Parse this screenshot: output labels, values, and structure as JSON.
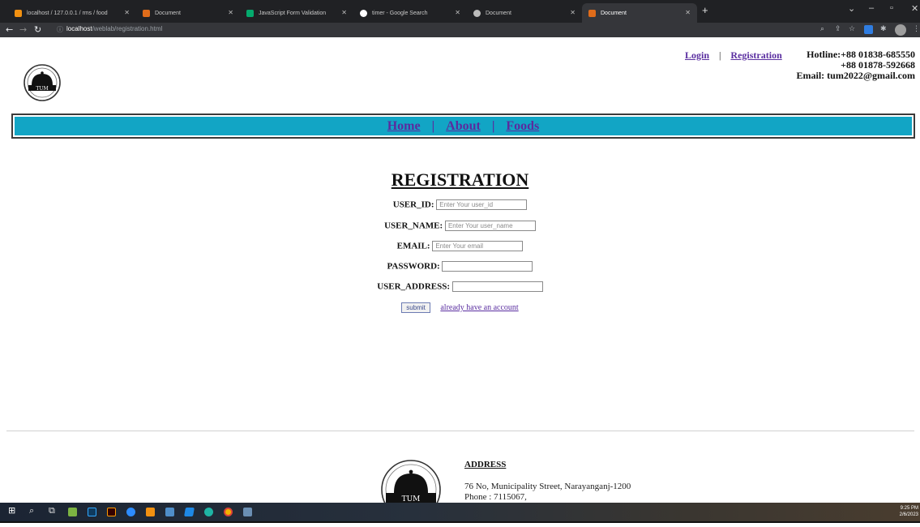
{
  "browser": {
    "tabs": [
      {
        "label": "localhost / 127.0.0.1 / rms / food",
        "icon": "phpmyadmin-icon",
        "color": "#f29111",
        "active": false
      },
      {
        "label": "Document",
        "icon": "document-icon",
        "color": "#e06c1a",
        "active": false
      },
      {
        "label": "JavaScript Form Validation",
        "icon": "w3schools-icon",
        "color": "#04aa6d",
        "active": false
      },
      {
        "label": "timer - Google Search",
        "icon": "google-icon",
        "color": "#ffffff",
        "active": false
      },
      {
        "label": "Document",
        "icon": "globe-icon",
        "color": "#bbbbbb",
        "active": false
      },
      {
        "label": "Document",
        "icon": "document-icon",
        "color": "#e06c1a",
        "active": true
      }
    ],
    "url_host": "localhost",
    "url_path": "/weblab/registration.html"
  },
  "header": {
    "login_label": "Login",
    "separator": "|",
    "registration_label": "Registration",
    "hotline_line1": "Hotline:+88 01838-685550",
    "hotline_line2": "+88 01878-592668",
    "email_line": "Email: tum2022@gmail.com",
    "logo_text": "TUM"
  },
  "menu": {
    "home": "Home",
    "about": "About",
    "foods": "Foods",
    "separator": "|"
  },
  "form": {
    "title": "REGISTRATION",
    "fields": [
      {
        "label": "USER_ID:",
        "placeholder": "Enter Your user_id"
      },
      {
        "label": "USER_NAME:",
        "placeholder": "Enter Your user_name"
      },
      {
        "label": "EMAIL:",
        "placeholder": "Enter Your email"
      },
      {
        "label": "PASSWORD:",
        "placeholder": ""
      },
      {
        "label": "USER_ADDRESS:",
        "placeholder": ""
      }
    ],
    "submit_label": "submit",
    "login_link": "already have an account"
  },
  "footer": {
    "address_heading": "ADDRESS",
    "address_line": "76 No, Municipality Street, Narayanganj-1200",
    "phone_line": "Phone : 7115067,"
  },
  "taskbar": {
    "time": "9:25 PM",
    "date": "2/6/2023"
  }
}
